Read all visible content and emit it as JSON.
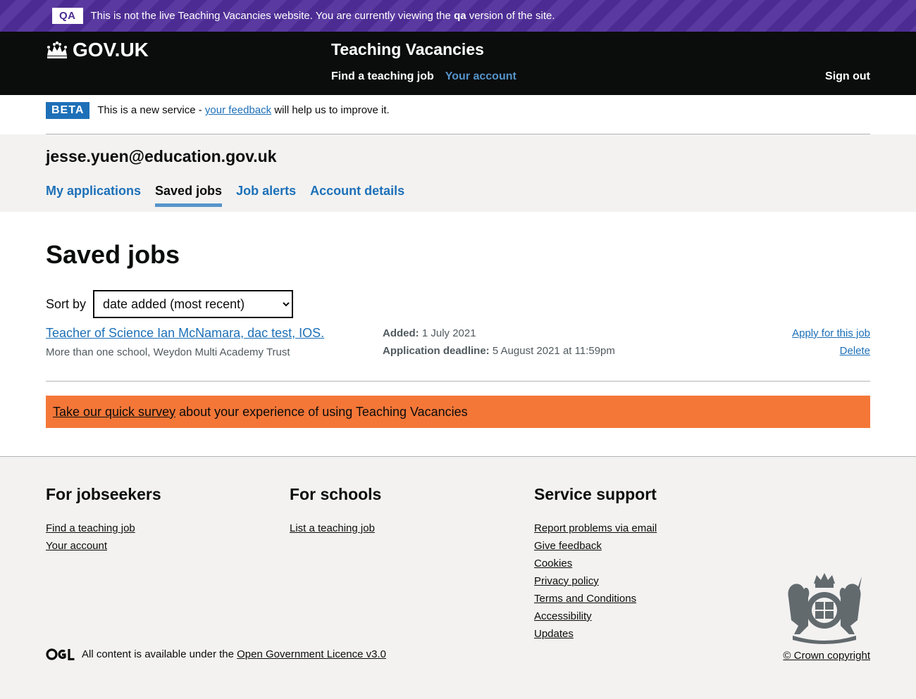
{
  "qa_banner": {
    "tag": "QA",
    "text_before": "This is not the live Teaching Vacancies website. You are currently viewing the ",
    "text_bold": "qa",
    "text_after": " version of the site."
  },
  "header": {
    "logo_text": "GOV.UK",
    "service_name": "Teaching Vacancies",
    "nav": {
      "find_job": "Find a teaching job",
      "your_account": "Your account"
    },
    "sign_out": "Sign out"
  },
  "beta_banner": {
    "tag": "BETA",
    "text_before": "This is a new service - ",
    "link": "your feedback",
    "text_after": " will help us to improve it."
  },
  "account": {
    "email": "jesse.yuen@education.gov.uk",
    "tabs": [
      "My applications",
      "Saved jobs",
      "Job alerts",
      "Account details"
    ],
    "active_tab": "Saved jobs"
  },
  "main": {
    "title": "Saved jobs",
    "sort": {
      "label": "Sort by",
      "selected": "date added (most recent)"
    },
    "jobs": [
      {
        "title": "Teacher of Science Ian McNamara, dac test, IOS.",
        "school": "More than one school, Weydon Multi Academy Trust",
        "added_label": "Added:",
        "added_value": "1 July 2021",
        "deadline_label": "Application deadline:",
        "deadline_value": "5 August 2021 at 11:59pm",
        "apply": "Apply for this job",
        "delete": "Delete"
      }
    ],
    "survey": {
      "link": "Take our quick survey",
      "text": " about your experience of using Teaching Vacancies"
    }
  },
  "footer": {
    "jobseekers": {
      "heading": "For jobseekers",
      "links": [
        "Find a teaching job",
        "Your account"
      ]
    },
    "schools": {
      "heading": "For schools",
      "links": [
        "List a teaching job"
      ]
    },
    "support": {
      "heading": "Service support",
      "links": [
        "Report problems via email",
        "Give feedback",
        "Cookies",
        "Privacy policy",
        "Terms and Conditions",
        "Accessibility",
        "Updates"
      ]
    },
    "licence_before": "All content is available under the ",
    "licence_link": "Open Government Licence v3.0",
    "copyright": "© Crown copyright"
  }
}
